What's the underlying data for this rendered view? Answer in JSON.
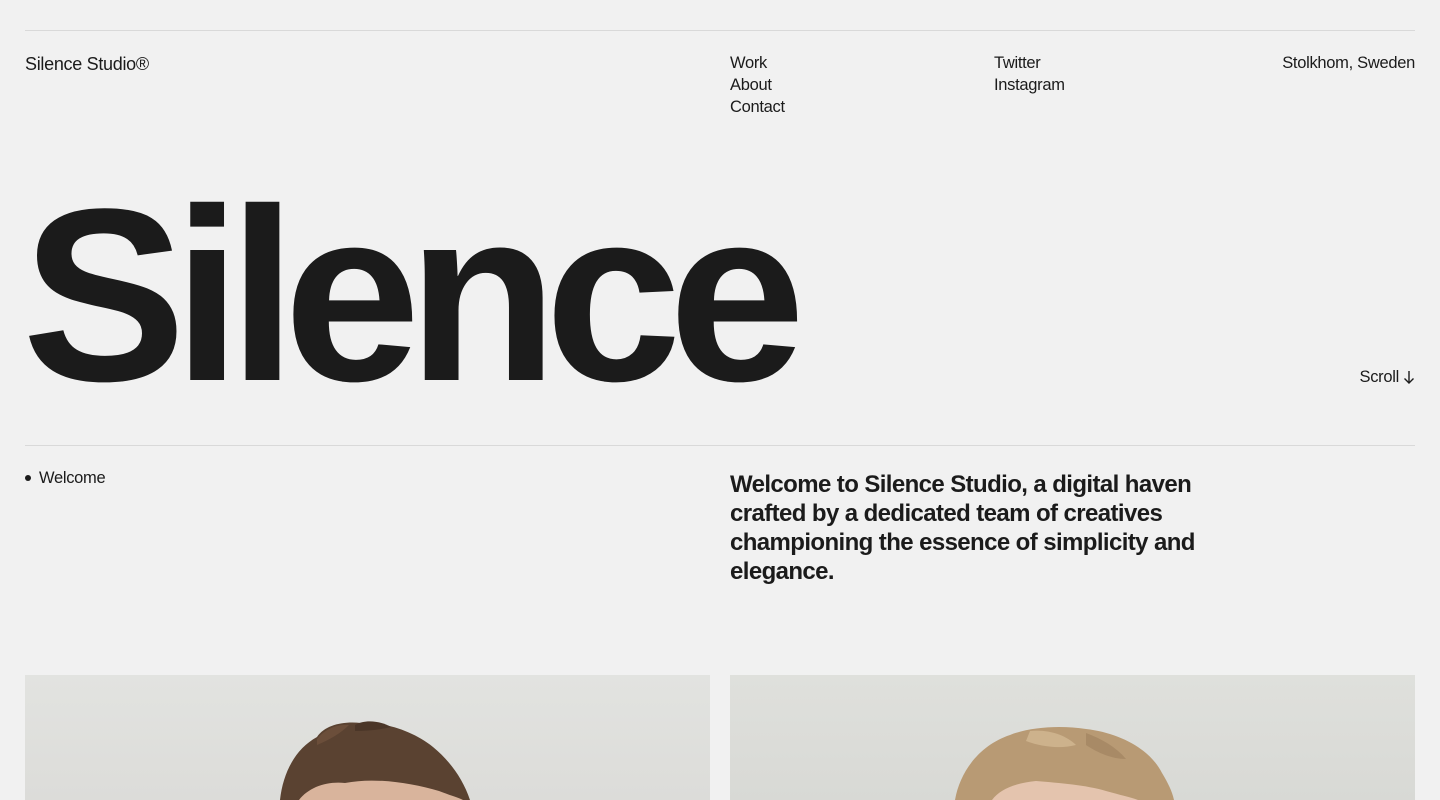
{
  "header": {
    "brand": "Silence Studio®",
    "nav": [
      {
        "label": "Work"
      },
      {
        "label": "About"
      },
      {
        "label": "Contact"
      }
    ],
    "social": [
      {
        "label": "Twitter"
      },
      {
        "label": "Instagram"
      }
    ],
    "location": "Stolkhom, Sweden"
  },
  "hero": {
    "word": "Silence",
    "scroll_label": "Scroll",
    "scroll_icon": "arrow-down-icon"
  },
  "intro": {
    "section_label": "Welcome",
    "text": "Welcome to Silence Studio, a digital haven crafted by a dedicated team of creatives championing the essence of simplicity and elegance."
  },
  "team_photos": [
    {
      "name": "team-member-photo-1"
    },
    {
      "name": "team-member-photo-2"
    }
  ],
  "colors": {
    "background": "#f1f1f1",
    "text": "#1b1b1b",
    "rule": "#d9d9d9"
  }
}
